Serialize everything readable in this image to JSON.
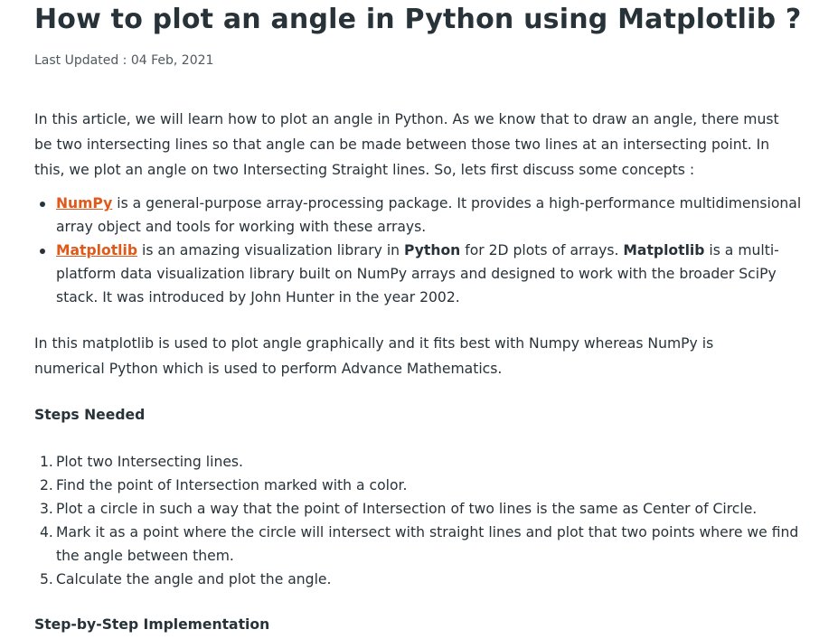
{
  "article": {
    "title": "How to plot an angle in Python using Matplotlib ?",
    "last_updated_label": "Last Updated :",
    "last_updated_date": "04 Feb, 2021",
    "intro": "In this article, we will learn how to plot an angle in Python. As we know that to draw an angle, there must be two intersecting lines so that angle can be made between those two lines at an intersecting point. In this, we plot an angle on two Intersecting Straight lines. So, lets first discuss some concepts :",
    "bullets": [
      {
        "link": "NumPy",
        "text": " is a general-purpose array-processing package. It provides a high-performance multidimensional array object and tools for working with these arrays."
      },
      {
        "link": "Matplotlib",
        "text_a": " is an amazing visualization library in ",
        "bold_a": "Python",
        "text_b": " for 2D plots of arrays. ",
        "bold_b": "Matplotlib",
        "text_c": " is a multi-platform data visualization library built on NumPy arrays and designed to work with the broader SciPy stack. It was introduced by John Hunter in the year 2002."
      }
    ],
    "para2": "In this matplotlib is used to plot angle graphically and it fits best with Numpy whereas NumPy is numerical Python which is used to perform Advance Mathematics.",
    "steps_heading": "Steps Needed",
    "steps": [
      "Plot two Intersecting lines.",
      "Find the point of Intersection marked with a color.",
      "Plot a circle in such a way that the point of Intersection of two lines is the same as Center of Circle.",
      "Mark it as a point where the circle will intersect with straight lines and plot that two points where we find the angle between them.",
      "Calculate the angle and plot the angle."
    ],
    "impl_heading": "Step-by-Step Implementation"
  },
  "colors": {
    "text": "#273239",
    "link": "#e0591b",
    "muted": "#4f5a60"
  }
}
